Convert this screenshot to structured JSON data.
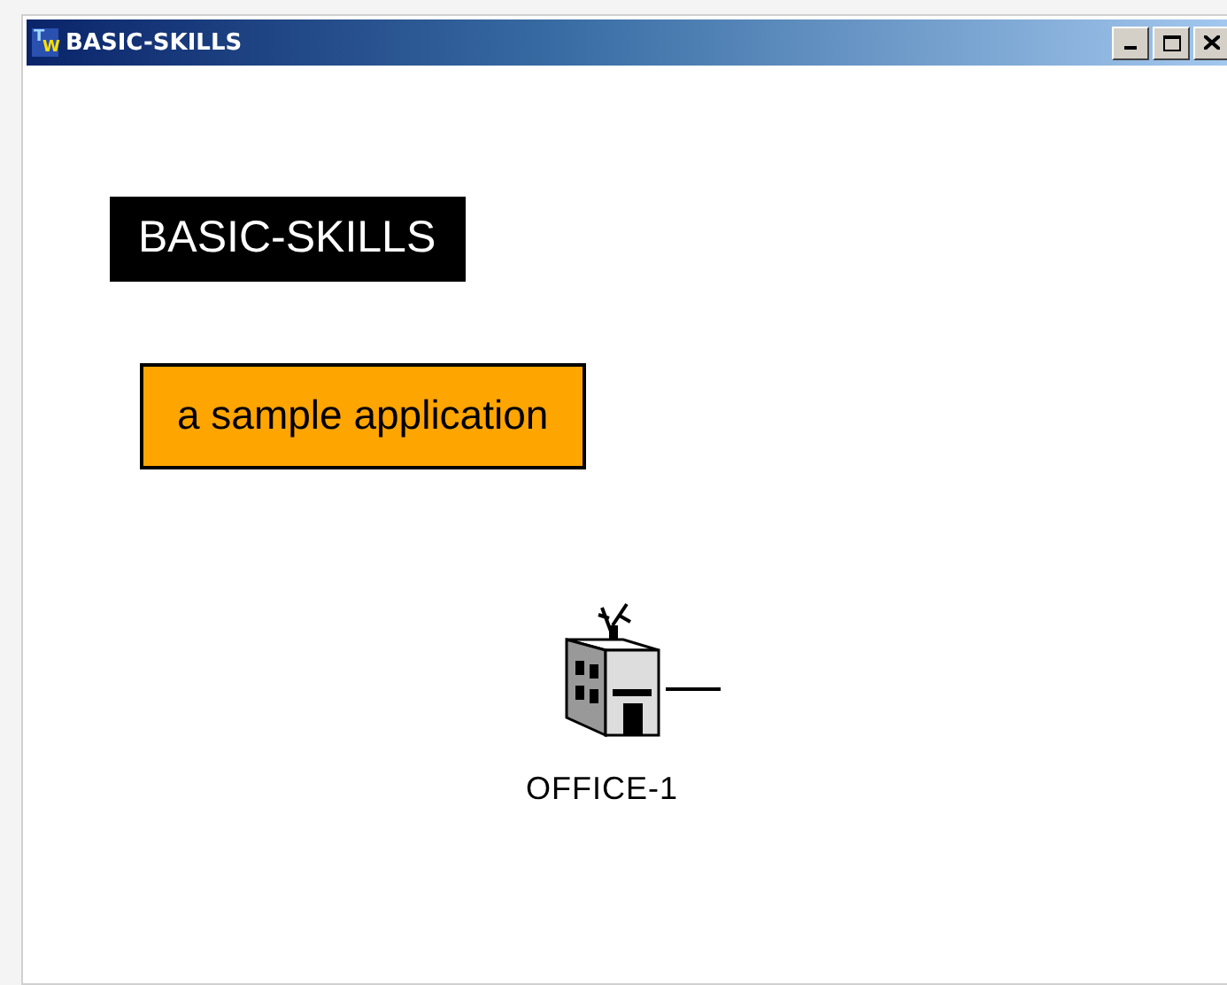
{
  "window": {
    "title": "BASIC-SKILLS",
    "icon_letters": [
      "T",
      "W"
    ]
  },
  "workspace": {
    "items": [
      {
        "kind": "title",
        "text": "BASIC-SKILLS"
      },
      {
        "kind": "label",
        "text": "a sample application"
      },
      {
        "kind": "office",
        "name": "OFFICE-1"
      }
    ]
  }
}
